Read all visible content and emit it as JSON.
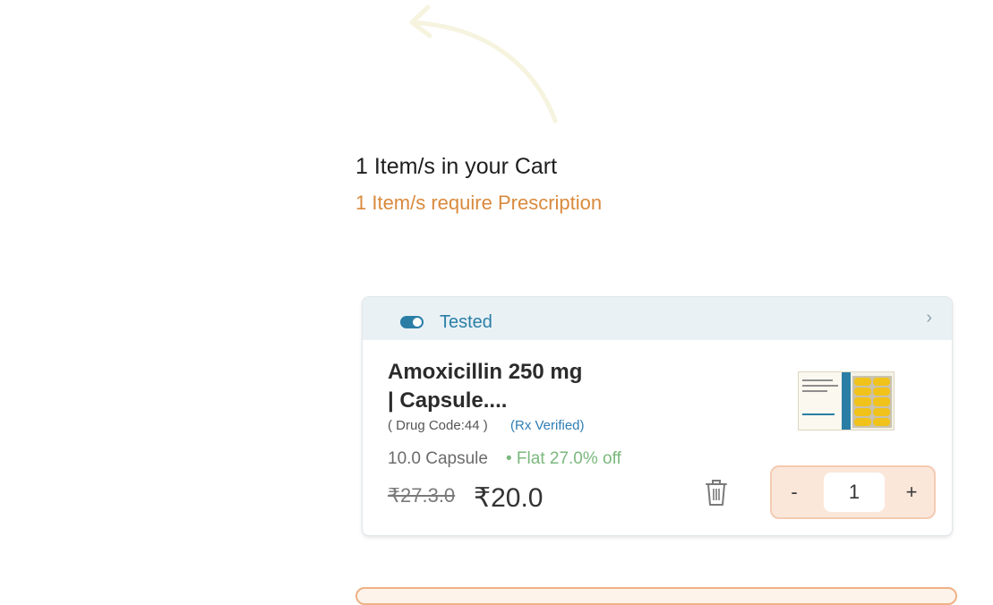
{
  "cart": {
    "count_text": "1 Item/s in your Cart",
    "rx_text": "1 Item/s require Prescription"
  },
  "item": {
    "tag_label": "Tested",
    "name_line1": "Amoxicillin 250 mg",
    "name_line2": "| Capsule....",
    "drug_code": "( Drug Code:44 )",
    "rx_status": "(Rx Verified)",
    "pack_size": "10.0 Capsule",
    "discount": "• Flat 27.0% off",
    "mrp": "₹27.3.0",
    "price": "₹20.0",
    "quantity": "1",
    "minus_label": "-",
    "plus_label": "+"
  },
  "colors": {
    "accent_orange": "#d98a3d",
    "accent_blue": "#2a7ea6",
    "discount_green": "#7ab87d",
    "stepper_bg": "#fbe7da"
  },
  "icons": {
    "header_toggle": "toggle-icon",
    "header_chevron": "chevron-right-icon",
    "delete": "trash-icon"
  }
}
